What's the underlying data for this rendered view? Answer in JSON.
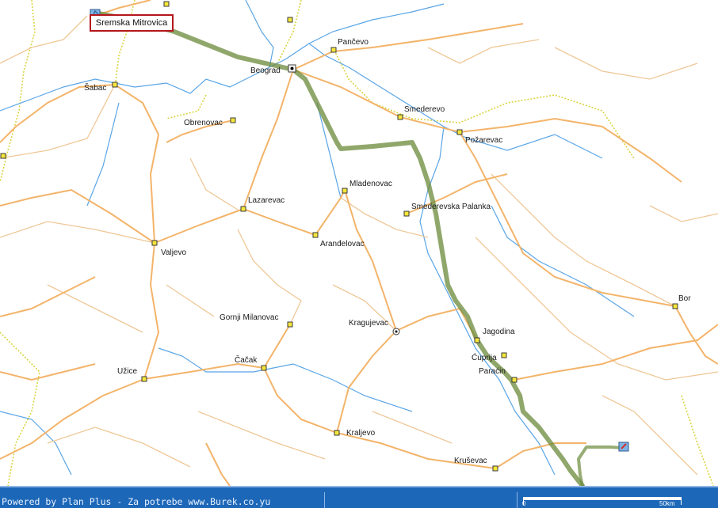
{
  "map": {
    "start_label": "Sremska Mitrovica",
    "cities": [
      {
        "name": "Pančevo"
      },
      {
        "name": "Beograd"
      },
      {
        "name": "Šabac"
      },
      {
        "name": "Obrenovac"
      },
      {
        "name": "Smederevo"
      },
      {
        "name": "Požarevac"
      },
      {
        "name": "Mladenovac"
      },
      {
        "name": "Lazarevac"
      },
      {
        "name": "Smederevska Palanka"
      },
      {
        "name": "Aranđelovac"
      },
      {
        "name": "Valjevo"
      },
      {
        "name": "Bor"
      },
      {
        "name": "Gornji Milanovac"
      },
      {
        "name": "Kragujevac"
      },
      {
        "name": "Jagodina"
      },
      {
        "name": "Ćuprija"
      },
      {
        "name": "Paraćin"
      },
      {
        "name": "Čačak"
      },
      {
        "name": "Užice"
      },
      {
        "name": "Kraljevo"
      },
      {
        "name": "Kruševac"
      }
    ],
    "colors": {
      "route": "#6b8a3a",
      "main_road": "#f3b46a",
      "secondary_road": "#efc898",
      "river": "#5aa5e6",
      "border": "#d9d441",
      "marker": "#f5e73a"
    }
  },
  "status_bar": {
    "credit": "Powered by Plan Plus - Za potrebe www.Burek.co.yu",
    "scale_zero": "0",
    "scale_label": "50km"
  }
}
